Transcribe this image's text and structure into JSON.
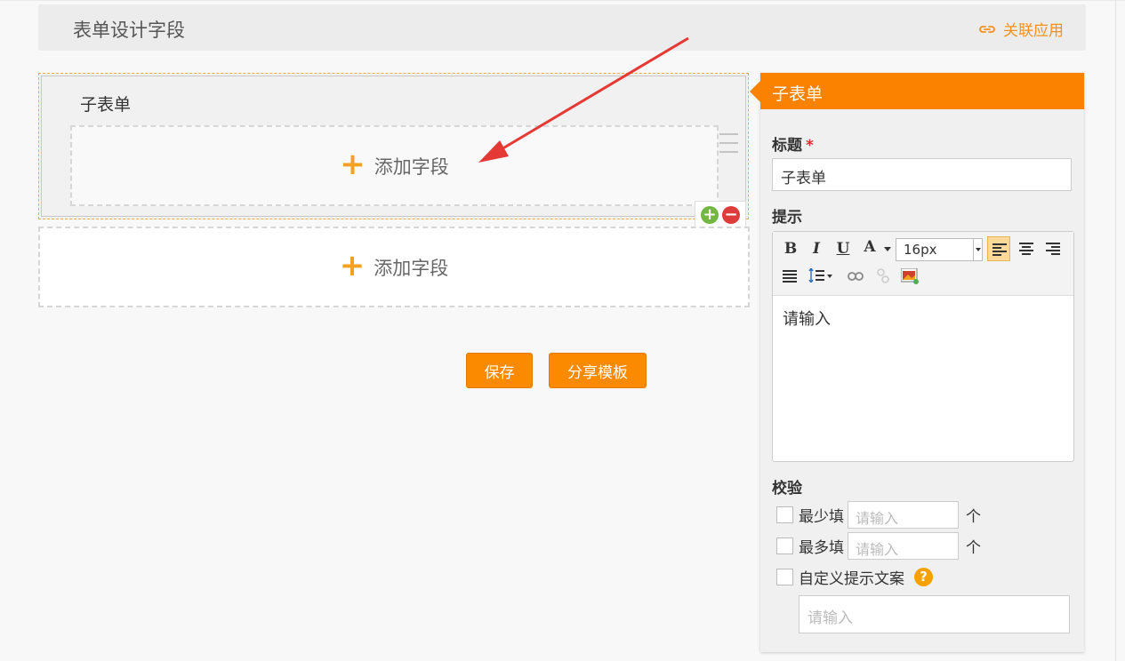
{
  "header": {
    "title": "表单设计字段",
    "link_label": "关联应用",
    "link_icon": "link-icon"
  },
  "canvas": {
    "subform_title": "子表单",
    "subform_add_label": "添加字段",
    "add_field_label": "添加字段",
    "buttons": {
      "save": "保存",
      "share_template": "分享模板"
    }
  },
  "panel": {
    "header": "子表单",
    "title_label": "标题",
    "required_mark": "*",
    "title_value": "子表单",
    "hint_label": "提示",
    "editor": {
      "bold": "B",
      "italic": "I",
      "underline": "U",
      "font_color": "A",
      "font_size": "16px",
      "content": "请输入"
    },
    "validation_label": "校验",
    "min_fill_label": "最少填",
    "max_fill_label": "最多填",
    "placeholder": "请输入",
    "unit": "个",
    "custom_hint_label": "自定义提示文案",
    "help_glyph": "?",
    "custom_placeholder": "请输入"
  },
  "colors": {
    "accent": "#fb8200",
    "arrow": "#e53935",
    "add_plus": "#f5a020"
  }
}
